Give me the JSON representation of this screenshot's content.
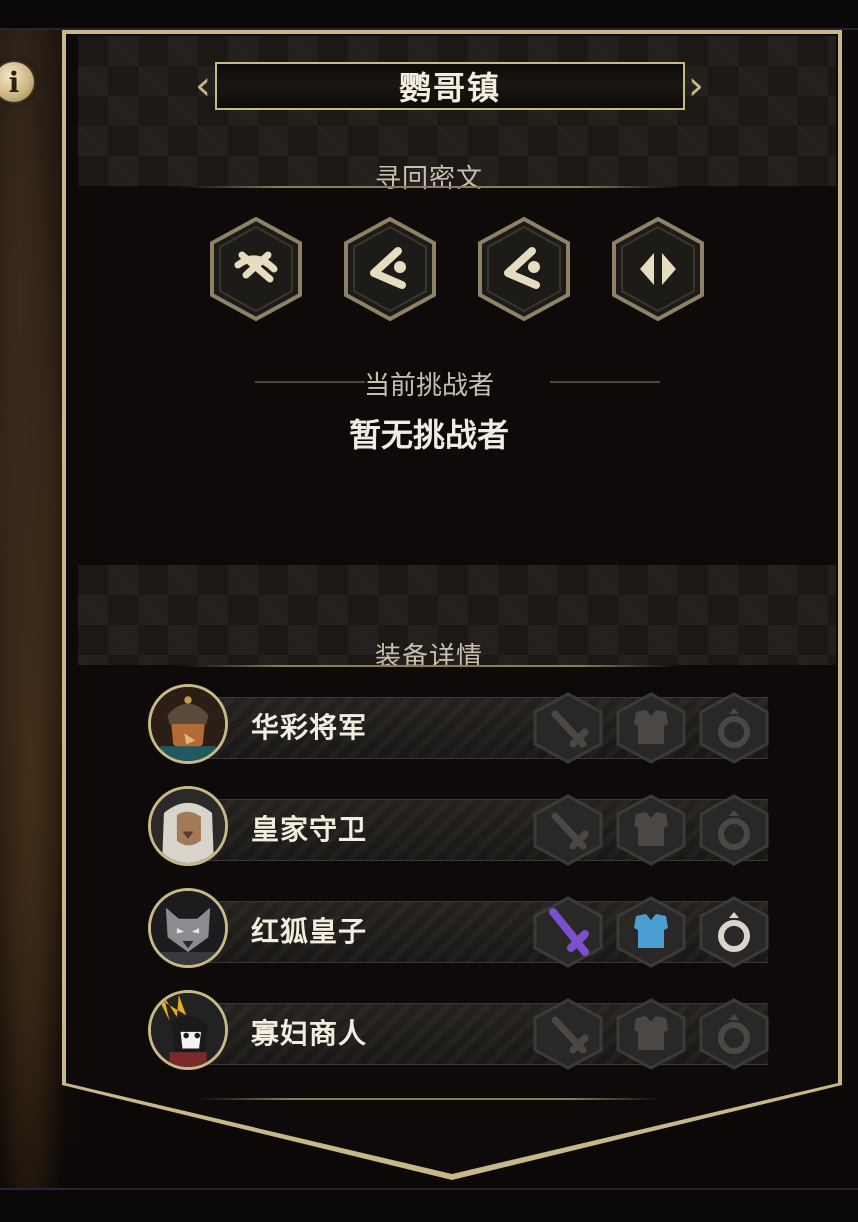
{
  "title": "鹦哥镇",
  "runes_label": "寻回密文",
  "runes": [
    "rune-1-icon",
    "rune-2-icon",
    "rune-3-icon",
    "rune-4-icon"
  ],
  "challenger": {
    "label": "当前挑战者",
    "value": "暂无挑战者"
  },
  "equipment_label": "装备详情",
  "characters": [
    {
      "name": "华彩将军",
      "avatar": "general-portrait",
      "sword_active": false,
      "armor_active": false,
      "ring_active": false
    },
    {
      "name": "皇家守卫",
      "avatar": "royal-guard-portrait",
      "sword_active": false,
      "armor_active": false,
      "ring_active": false
    },
    {
      "name": "红狐皇子",
      "avatar": "fox-prince-portrait",
      "sword_active": true,
      "armor_active": true,
      "ring_active": true
    },
    {
      "name": "寡妇商人",
      "avatar": "widow-merchant-portrait",
      "sword_active": false,
      "armor_active": false,
      "ring_active": false
    }
  ],
  "colors": {
    "gold": "#c8b888",
    "sword_active": "#7b4fd0",
    "armor_active": "#4b9ed1",
    "ring_active": "#d9d4cc",
    "inactive": "#4a4744"
  }
}
